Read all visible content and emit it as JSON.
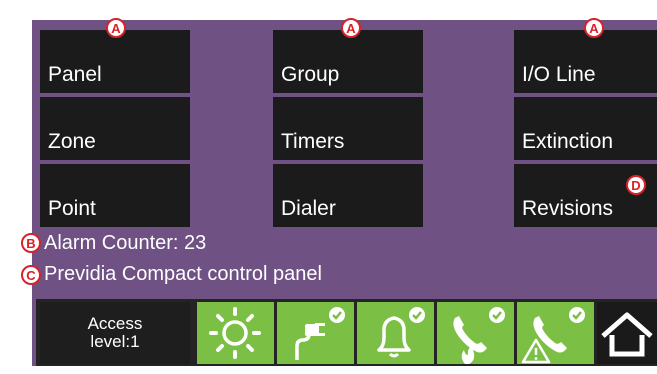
{
  "menu": [
    {
      "label": "Panel"
    },
    {
      "label": "Group"
    },
    {
      "label": "I/O Line"
    },
    {
      "label": "Zone"
    },
    {
      "label": "Timers"
    },
    {
      "label": "Extinction"
    },
    {
      "label": "Point"
    },
    {
      "label": "Dialer"
    },
    {
      "label": "Revisions"
    }
  ],
  "callouts": {
    "a1": "A",
    "a2": "A",
    "a3": "A",
    "b": "B",
    "c": "C",
    "d": "D"
  },
  "status": {
    "alarm_counter": "Alarm Counter: 23",
    "panel_name": "Previdia Compact control panel"
  },
  "bottom_bar": {
    "access_line1": "Access",
    "access_line2": "level:1",
    "tiles": [
      {
        "icon": "sun-icon"
      },
      {
        "icon": "power-plug-check-icon"
      },
      {
        "icon": "bell-check-icon"
      },
      {
        "icon": "phone-fire-check-icon"
      },
      {
        "icon": "phone-warning-check-icon"
      },
      {
        "icon": "home-icon"
      }
    ]
  },
  "colors": {
    "panel": "#6f5184",
    "button": "#1b1b1b",
    "tile": "#7bc044",
    "callout": "#d6232a"
  }
}
